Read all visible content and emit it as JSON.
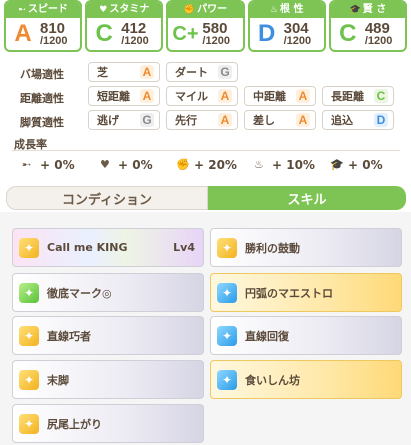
{
  "stats": [
    {
      "label": "スピード",
      "icon": "speed-icon",
      "glyph": "➸",
      "grade": "A",
      "gclass": "g-A",
      "value": "810",
      "max": "/1200"
    },
    {
      "label": "スタミナ",
      "icon": "heart-icon",
      "glyph": "♥",
      "grade": "C",
      "gclass": "g-C",
      "value": "412",
      "max": "/1200"
    },
    {
      "label": "パワー",
      "icon": "muscle-icon",
      "glyph": "✊",
      "grade": "C+",
      "gclass": "g-Cp",
      "value": "580",
      "max": "/1200"
    },
    {
      "label": "根 性",
      "icon": "flame-icon",
      "glyph": "♨",
      "grade": "D",
      "gclass": "g-D",
      "value": "304",
      "max": "/1200"
    },
    {
      "label": "賢 さ",
      "icon": "cap-icon",
      "glyph": "🎓",
      "grade": "C",
      "gclass": "g-C",
      "value": "489",
      "max": "/1200"
    }
  ],
  "aptitude": {
    "track_label": "バ場適性",
    "distance_label": "距離適性",
    "style_label": "脚質適性",
    "track": [
      {
        "name": "芝",
        "grade": "A"
      },
      {
        "name": "ダート",
        "grade": "G"
      }
    ],
    "distance": [
      {
        "name": "短距離",
        "grade": "A"
      },
      {
        "name": "マイル",
        "grade": "A"
      },
      {
        "name": "中距離",
        "grade": "A"
      },
      {
        "name": "長距離",
        "grade": "C"
      }
    ],
    "style": [
      {
        "name": "逃げ",
        "grade": "G"
      },
      {
        "name": "先行",
        "grade": "A"
      },
      {
        "name": "差し",
        "grade": "A"
      },
      {
        "name": "追込",
        "grade": "D"
      }
    ]
  },
  "growth": {
    "title": "成長率",
    "items": [
      {
        "icon": "speed-icon",
        "glyph": "➸",
        "text": "+ 0%"
      },
      {
        "icon": "heart-icon",
        "glyph": "♥",
        "text": "+ 0%"
      },
      {
        "icon": "muscle-icon",
        "glyph": "✊",
        "text": "+ 20%"
      },
      {
        "icon": "flame-icon",
        "glyph": "♨",
        "text": "+ 10%"
      },
      {
        "icon": "cap-icon",
        "glyph": "🎓",
        "text": "+ 0%"
      }
    ]
  },
  "tabs": {
    "condition": "コンディション",
    "skill": "スキル"
  },
  "skills": [
    {
      "name": "Call me KING",
      "level": "Lv4",
      "style": "rainbow",
      "icon": "ic-rainbow"
    },
    {
      "name": "勝利の鼓動",
      "level": "",
      "style": "normal",
      "icon": "ic-yellow"
    },
    {
      "name": "徹底マーク◎",
      "level": "",
      "style": "normal",
      "icon": "ic-green"
    },
    {
      "name": "円弧のマエストロ",
      "level": "",
      "style": "gold",
      "icon": "ic-blue"
    },
    {
      "name": "直線巧者",
      "level": "",
      "style": "normal",
      "icon": "ic-yellow"
    },
    {
      "name": "直線回復",
      "level": "",
      "style": "normal",
      "icon": "ic-blue"
    },
    {
      "name": "末脚",
      "level": "",
      "style": "normal",
      "icon": "ic-yellow"
    },
    {
      "name": "食いしん坊",
      "level": "",
      "style": "gold",
      "icon": "ic-blue"
    },
    {
      "name": "尻尾上がり",
      "level": "",
      "style": "normal",
      "icon": "ic-yellow"
    }
  ]
}
